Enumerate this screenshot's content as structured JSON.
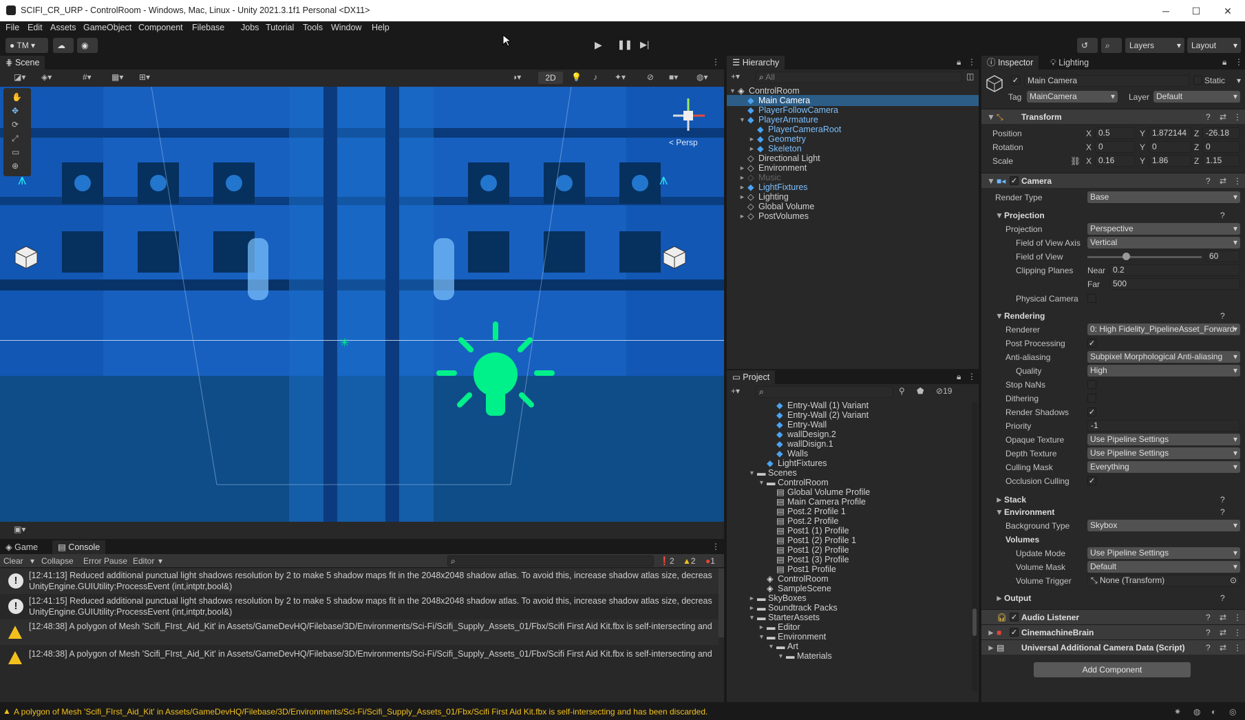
{
  "window": {
    "title": "SCIFI_CR_URP - ControlRoom - Windows, Mac, Linux - Unity 2021.3.1f1 Personal <DX11>"
  },
  "menu": [
    "File",
    "Edit",
    "Assets",
    "GameObject",
    "Component",
    "Filebase",
    "Jobs",
    "Tutorial",
    "Tools",
    "Window",
    "Help"
  ],
  "toolbar": {
    "account": "TM",
    "layers": "Layers",
    "layout": "Layout"
  },
  "scene": {
    "tab": "Scene",
    "mode_2d": "2D",
    "persp": "< Persp"
  },
  "hierarchy": {
    "tab": "Hierarchy",
    "search_placeholder": "All",
    "rows": [
      {
        "label": "ControlRoom",
        "depth": 0,
        "arrow": "▼",
        "kind": "scene"
      },
      {
        "label": "Main Camera",
        "depth": 1,
        "arrow": "",
        "kind": "blue",
        "selected": true
      },
      {
        "label": "PlayerFollowCamera",
        "depth": 1,
        "arrow": "",
        "kind": "blue"
      },
      {
        "label": "PlayerArmature",
        "depth": 1,
        "arrow": "▼",
        "kind": "blue"
      },
      {
        "label": "PlayerCameraRoot",
        "depth": 2,
        "arrow": "",
        "kind": "blue"
      },
      {
        "label": "Geometry",
        "depth": 2,
        "arrow": "►",
        "kind": "blue"
      },
      {
        "label": "Skeleton",
        "depth": 2,
        "arrow": "►",
        "kind": "blue"
      },
      {
        "label": "Directional Light",
        "depth": 1,
        "arrow": "",
        "kind": "grey"
      },
      {
        "label": "Environment",
        "depth": 1,
        "arrow": "►",
        "kind": "grey"
      },
      {
        "label": "Music",
        "depth": 1,
        "arrow": "►",
        "kind": "dim"
      },
      {
        "label": "LightFixtures",
        "depth": 1,
        "arrow": "►",
        "kind": "blue"
      },
      {
        "label": "Lighting",
        "depth": 1,
        "arrow": "►",
        "kind": "grey"
      },
      {
        "label": "Global Volume",
        "depth": 1,
        "arrow": "",
        "kind": "grey"
      },
      {
        "label": "PostVolumes",
        "depth": 1,
        "arrow": "►",
        "kind": "grey"
      }
    ]
  },
  "project": {
    "tab": "Project",
    "count": "19",
    "rows": [
      {
        "label": "Entry-Wall (1) Variant",
        "depth": 4,
        "arrow": "",
        "kind": "prefab"
      },
      {
        "label": "Entry-Wall (2) Variant",
        "depth": 4,
        "arrow": "",
        "kind": "prefab"
      },
      {
        "label": "Entry-Wall",
        "depth": 4,
        "arrow": "",
        "kind": "prefab"
      },
      {
        "label": "wallDesign.2",
        "depth": 4,
        "arrow": "",
        "kind": "prefab"
      },
      {
        "label": "wallDisign.1",
        "depth": 4,
        "arrow": "",
        "kind": "prefab"
      },
      {
        "label": "Walls",
        "depth": 4,
        "arrow": "",
        "kind": "prefab"
      },
      {
        "label": "LightFixtures",
        "depth": 3,
        "arrow": "",
        "kind": "prefab"
      },
      {
        "label": "Scenes",
        "depth": 2,
        "arrow": "▼",
        "kind": "folder"
      },
      {
        "label": "ControlRoom",
        "depth": 3,
        "arrow": "▼",
        "kind": "folder"
      },
      {
        "label": "Global Volume Profile",
        "depth": 4,
        "arrow": "",
        "kind": "asset"
      },
      {
        "label": "Main Camera Profile",
        "depth": 4,
        "arrow": "",
        "kind": "asset"
      },
      {
        "label": "Post.2 Profile 1",
        "depth": 4,
        "arrow": "",
        "kind": "asset"
      },
      {
        "label": "Post.2 Profile",
        "depth": 4,
        "arrow": "",
        "kind": "asset"
      },
      {
        "label": "Post1 (1) Profile",
        "depth": 4,
        "arrow": "",
        "kind": "asset"
      },
      {
        "label": "Post1 (2) Profile 1",
        "depth": 4,
        "arrow": "",
        "kind": "asset"
      },
      {
        "label": "Post1 (2) Profile",
        "depth": 4,
        "arrow": "",
        "kind": "asset"
      },
      {
        "label": "Post1 (3) Profile",
        "depth": 4,
        "arrow": "",
        "kind": "asset"
      },
      {
        "label": "Post1 Profile",
        "depth": 4,
        "arrow": "",
        "kind": "asset"
      },
      {
        "label": "ControlRoom",
        "depth": 3,
        "arrow": "",
        "kind": "scene"
      },
      {
        "label": "SampleScene",
        "depth": 3,
        "arrow": "",
        "kind": "scene"
      },
      {
        "label": "SkyBoxes",
        "depth": 2,
        "arrow": "►",
        "kind": "folder"
      },
      {
        "label": "Soundtrack Packs",
        "depth": 2,
        "arrow": "►",
        "kind": "folder"
      },
      {
        "label": "StarterAssets",
        "depth": 2,
        "arrow": "▼",
        "kind": "folder"
      },
      {
        "label": "Editor",
        "depth": 3,
        "arrow": "►",
        "kind": "folder"
      },
      {
        "label": "Environment",
        "depth": 3,
        "arrow": "▼",
        "kind": "folder"
      },
      {
        "label": "Art",
        "depth": 4,
        "arrow": "▼",
        "kind": "folder"
      },
      {
        "label": "Materials",
        "depth": 5,
        "arrow": "▼",
        "kind": "folder"
      }
    ]
  },
  "inspector": {
    "tab": "Inspector",
    "tab2": "Lighting",
    "object_name": "Main Camera",
    "static_label": "Static",
    "tag_label": "Tag",
    "tag": "MainCamera",
    "layer_label": "Layer",
    "layer": "Default",
    "transform": {
      "title": "Transform",
      "position_label": "Position",
      "position": {
        "x": "0.5",
        "y": "1.872144",
        "z": "-26.18"
      },
      "rotation_label": "Rotation",
      "rotation": {
        "x": "0",
        "y": "0",
        "z": "0"
      },
      "scale_label": "Scale",
      "scale": {
        "x": "0.16",
        "y": "1.86",
        "z": "1.15"
      }
    },
    "camera": {
      "title": "Camera",
      "render_type_label": "Render Type",
      "render_type": "Base",
      "projection_header": "Projection",
      "projection_label": "Projection",
      "projection": "Perspective",
      "fov_axis_label": "Field of View Axis",
      "fov_axis": "Vertical",
      "fov_label": "Field of View",
      "fov": "60",
      "clip_label": "Clipping Planes",
      "near_label": "Near",
      "near": "0.2",
      "far_label": "Far",
      "far": "500",
      "physical_label": "Physical Camera",
      "rendering_header": "Rendering",
      "renderer_label": "Renderer",
      "renderer": "0: High Fidelity_PipelineAsset_Forward",
      "post_label": "Post Processing",
      "aa_label": "Anti-aliasing",
      "aa": "Subpixel Morphological Anti-aliasing",
      "quality_label": "Quality",
      "quality": "High",
      "stopnans_label": "Stop NaNs",
      "dither_label": "Dithering",
      "shadows_label": "Render Shadows",
      "priority_label": "Priority",
      "priority": "-1",
      "opaque_label": "Opaque Texture",
      "opaque": "Use Pipeline Settings",
      "depth_label": "Depth Texture",
      "depth": "Use Pipeline Settings",
      "culling_label": "Culling Mask",
      "culling": "Everything",
      "occlusion_label": "Occlusion Culling",
      "stack_header": "Stack",
      "env_header": "Environment",
      "bg_label": "Background Type",
      "bg": "Skybox",
      "volumes_header": "Volumes",
      "update_label": "Update Mode",
      "update": "Use Pipeline Settings",
      "vmask_label": "Volume Mask",
      "vmask": "Default",
      "vtrigger_label": "Volume Trigger",
      "vtrigger": "None (Transform)",
      "output_header": "Output"
    },
    "components": [
      "Audio Listener",
      "CinemachineBrain",
      "Universal Additional Camera Data (Script)"
    ],
    "add_component": "Add Component"
  },
  "console": {
    "tab_game": "Game",
    "tab_console": "Console",
    "clear": "Clear",
    "collapse": "Collapse",
    "error_pause": "Error Pause",
    "editor": "Editor",
    "count_info": "2",
    "count_warn": "2",
    "count_err": "1",
    "rows": [
      {
        "type": "info",
        "line1": "[12:41:13] Reduced additional punctual light shadows resolution by 2 to make 5 shadow maps fit in the 2048x2048 shadow atlas. To avoid this, increase shadow atlas size, decreas",
        "line2": "UnityEngine.GUIUtility:ProcessEvent (int,intptr,bool&)"
      },
      {
        "type": "info",
        "line1": "[12:41:15] Reduced additional punctual light shadows resolution by 2 to make 5 shadow maps fit in the 2048x2048 shadow atlas. To avoid this, increase shadow atlas size, decreas",
        "line2": "UnityEngine.GUIUtility:ProcessEvent (int,intptr,bool&)"
      },
      {
        "type": "warn",
        "line1": "[12:48:38] A polygon of Mesh 'Scifi_FIrst_Aid_Kit' in Assets/GameDevHQ/Filebase/3D/Environments/Sci-Fi/Scifi_Supply_Assets_01/Fbx/Scifi First Aid Kit.fbx is self-intersecting and",
        "line2": ""
      },
      {
        "type": "warn",
        "line1": "[12:48:38] A polygon of Mesh 'Scifi_FIrst_Aid_Kit' in Assets/GameDevHQ/Filebase/3D/Environments/Sci-Fi/Scifi_Supply_Assets_01/Fbx/Scifi First Aid Kit.fbx is self-intersecting and",
        "line2": ""
      }
    ]
  },
  "status": {
    "message": "A polygon of Mesh 'Scifi_FIrst_Aid_Kit' in Assets/GameDevHQ/Filebase/3D/Environments/Sci-Fi/Scifi_Supply_Assets_01/Fbx/Scifi First Aid Kit.fbx is self-intersecting and has been discarded."
  },
  "colors": {
    "accent": "#2c5d87",
    "warning": "#f2c01d",
    "scene_blue": "#1460c0",
    "bulb": "#00f08a"
  }
}
